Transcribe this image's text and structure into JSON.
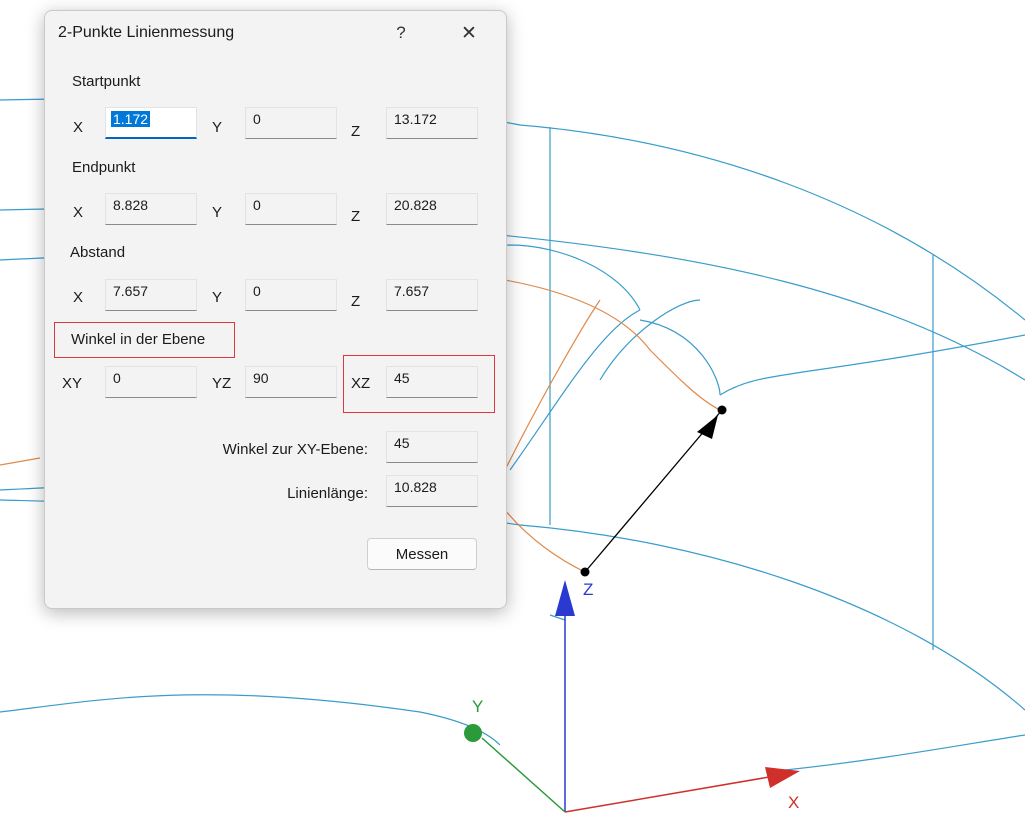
{
  "dialog": {
    "title": "2-Punkte Linienmessung",
    "help_label": "?",
    "close_label": "✕",
    "startpunkt": {
      "heading": "Startpunkt",
      "x_label": "X",
      "y_label": "Y",
      "z_label": "Z",
      "x": "1.172",
      "y": "0",
      "z": "13.172"
    },
    "endpunkt": {
      "heading": "Endpunkt",
      "x_label": "X",
      "y_label": "Y",
      "z_label": "Z",
      "x": "8.828",
      "y": "0",
      "z": "20.828"
    },
    "abstand": {
      "heading": "Abstand",
      "x_label": "X",
      "y_label": "Y",
      "z_label": "Z",
      "x": "7.657",
      "y": "0",
      "z": "7.657"
    },
    "winkel": {
      "heading": "Winkel in der Ebene",
      "xy_label": "XY",
      "yz_label": "YZ",
      "xz_label": "XZ",
      "xy": "0",
      "yz": "90",
      "xz": "45"
    },
    "winkel_xy_ebene": {
      "label": "Winkel zur XY-Ebene:",
      "value": "45"
    },
    "linienlaenge": {
      "label": "Linienlänge:",
      "value": "10.828"
    },
    "measure_button": "Messen"
  },
  "viewport": {
    "axis_x_label": "X",
    "axis_y_label": "Y",
    "axis_z_label": "Z",
    "colors": {
      "curve": "#3a9ccb",
      "orange_curve": "#e08a4a",
      "x_axis": "#d0302a",
      "y_axis": "#2a9a3a",
      "z_axis": "#2a3ad0",
      "highlight": "#d9393f"
    }
  }
}
